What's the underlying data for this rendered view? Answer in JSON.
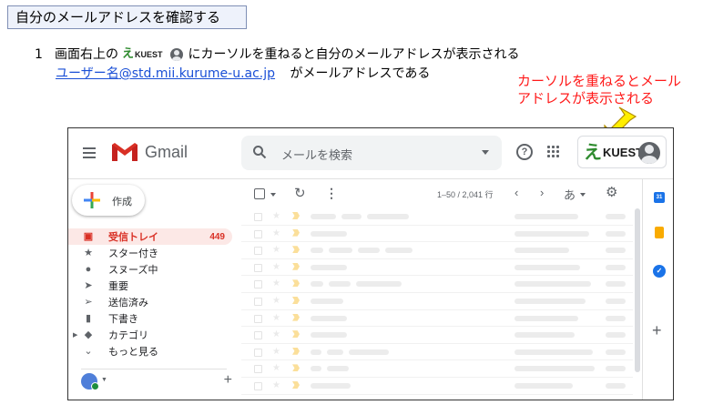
{
  "slide": {
    "title": "自分のメールアドレスを確認する",
    "step_number": "1",
    "step_text_before": "画面右上の",
    "step_text_after": "にカーソルを重ねると自分のメールアドレスが表示される",
    "email_user": "ユーザー名",
    "email_domain": "@std.mii.kurume-u.ac.jp",
    "email_suffix": "がメールアドレスである",
    "callout_line1": "カーソルを重ねるとメール",
    "callout_line2": "アドレスが表示される"
  },
  "colors": {
    "callout_red": "#ff1a1a",
    "link_blue": "#1a4fd6",
    "arrow_yellow": "#ffee00",
    "gmail_red": "#d93025",
    "kuest_green": "#2e8b2e"
  },
  "gmail": {
    "wordmark": "Gmail",
    "search_placeholder": "メールを検索",
    "account_logo_mark": "え",
    "account_logo_text": "KUEST",
    "compose_label": "作成",
    "nav": [
      {
        "label": "受信トレイ",
        "icon": "inbox-icon",
        "count": "449",
        "active": true
      },
      {
        "label": "スター付き",
        "icon": "star-icon"
      },
      {
        "label": "スヌーズ中",
        "icon": "clock-icon"
      },
      {
        "label": "重要",
        "icon": "important-icon"
      },
      {
        "label": "送信済み",
        "icon": "send-icon"
      },
      {
        "label": "下書き",
        "icon": "draft-icon"
      },
      {
        "label": "カテゴリ",
        "icon": "label-icon"
      },
      {
        "label": "もっと見る",
        "icon": "chevron-down-icon"
      }
    ],
    "page_range": "1–50 / 2,041 行",
    "ime_label": "あ",
    "help_glyph": "?",
    "calendar_glyph": "31",
    "tasks_glyph": "✓"
  }
}
